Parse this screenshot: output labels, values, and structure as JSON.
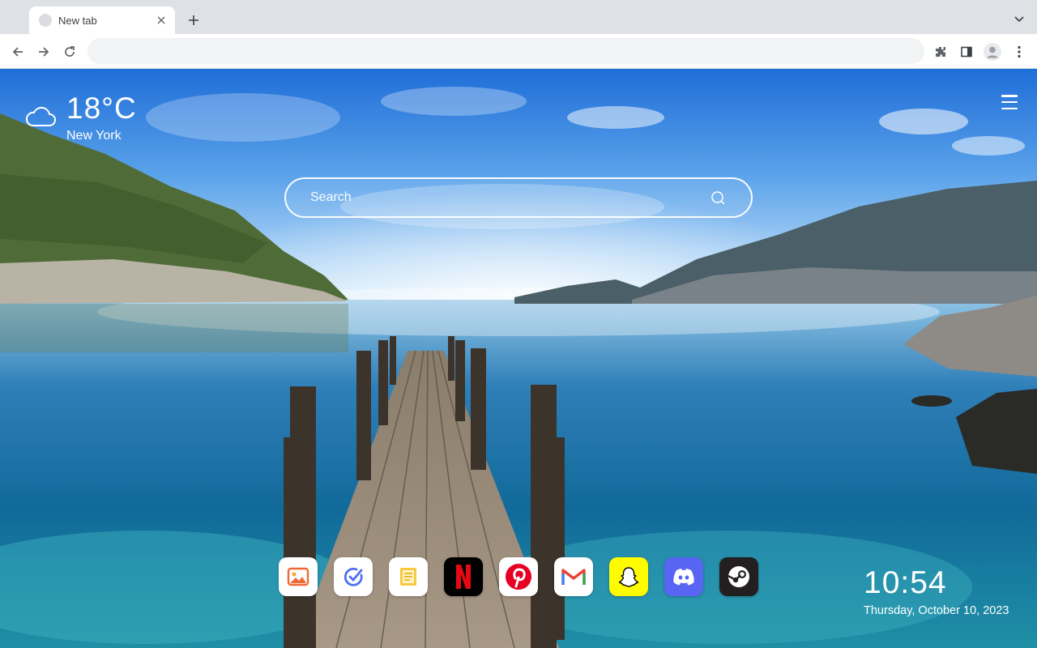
{
  "browser": {
    "tab": {
      "title": "New tab"
    },
    "omnibox": {
      "value": "",
      "placeholder": ""
    }
  },
  "weather": {
    "temperature": "18°C",
    "city": "New York",
    "icon": "cloud-icon"
  },
  "search": {
    "placeholder": "Search"
  },
  "shortcuts": [
    {
      "name": "photos-app",
      "icon": "photo-icon",
      "color": "#ffffff"
    },
    {
      "name": "task-app",
      "icon": "check-circle-icon",
      "color": "#ffffff"
    },
    {
      "name": "notes-app",
      "icon": "note-icon",
      "color": "#ffffff"
    },
    {
      "name": "netflix",
      "icon": "netflix-icon",
      "color": "#000000"
    },
    {
      "name": "pinterest",
      "icon": "pinterest-icon",
      "color": "#ffffff"
    },
    {
      "name": "gmail",
      "icon": "gmail-icon",
      "color": "#ffffff"
    },
    {
      "name": "snapchat",
      "icon": "snapchat-icon",
      "color": "#fffc00"
    },
    {
      "name": "discord",
      "icon": "discord-icon",
      "color": "#5865f2"
    },
    {
      "name": "steam",
      "icon": "steam-icon",
      "color": "#231f20"
    }
  ],
  "clock": {
    "time": "10:54",
    "date": "Thursday, October 10, 2023"
  }
}
